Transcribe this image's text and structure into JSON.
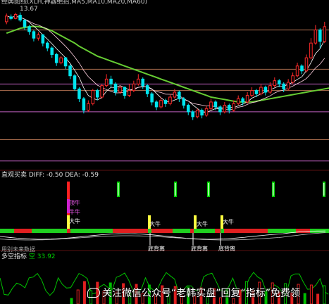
{
  "header": {
    "title_line": "经典图线(XLH,神器绝招,MA5,MA10,MA20,MA60)",
    "price_label": "13.67"
  },
  "macd_panel": {
    "title": "直观买卖",
    "diff_label": "DIFF: -0.50",
    "dea_label": "DEA: -0.59",
    "red_tag_top": "顶牛",
    "red_tag_mid": "牛牛",
    "signal_labels": [
      "大牛",
      "大牛",
      "大牛",
      "大牛"
    ],
    "divergence_labels": [
      "底背离",
      "底背离",
      "底背离"
    ]
  },
  "lower_panel": {
    "subtitle": "用别未来数据",
    "indicator_title": "多空指标",
    "indicator_value": "空 33.92"
  },
  "watermark": {
    "text": "关注微信公众号“老韩实盘”回复“指标”免费领"
  },
  "colors": {
    "up": "#ff2a2a",
    "down": "#00e5ee",
    "ma_long": "#66cc33",
    "grid_purple": "#c060c0",
    "grid_brown": "#b07050",
    "signal_green": "#00d000",
    "signal_yellow": "#ffff40",
    "signal_red": "#ff2020"
  },
  "chart_data": {
    "type": "candlestick",
    "candles": [
      {
        "o": 13.1,
        "c": 13.45,
        "h": 13.6,
        "l": 12.95
      },
      {
        "o": 13.4,
        "c": 13.3,
        "h": 13.55,
        "l": 13.2
      },
      {
        "o": 13.3,
        "c": 13.55,
        "h": 13.65,
        "l": 13.25
      },
      {
        "o": 13.5,
        "c": 13.2,
        "h": 13.67,
        "l": 13.1
      },
      {
        "o": 13.2,
        "c": 12.8,
        "h": 13.25,
        "l": 12.6
      },
      {
        "o": 12.8,
        "c": 12.5,
        "h": 12.9,
        "l": 12.3
      },
      {
        "o": 12.5,
        "c": 12.1,
        "h": 12.6,
        "l": 11.9
      },
      {
        "o": 12.1,
        "c": 12.3,
        "h": 12.45,
        "l": 11.95
      },
      {
        "o": 12.3,
        "c": 11.8,
        "h": 12.35,
        "l": 11.6
      },
      {
        "o": 11.8,
        "c": 11.5,
        "h": 11.9,
        "l": 11.3
      },
      {
        "o": 11.5,
        "c": 11.1,
        "h": 11.6,
        "l": 10.9
      },
      {
        "o": 11.1,
        "c": 10.6,
        "h": 11.2,
        "l": 10.4
      },
      {
        "o": 10.6,
        "c": 10.9,
        "h": 11.0,
        "l": 10.5
      },
      {
        "o": 10.9,
        "c": 10.4,
        "h": 10.95,
        "l": 10.2
      },
      {
        "o": 10.4,
        "c": 9.8,
        "h": 10.5,
        "l": 9.6
      },
      {
        "o": 9.8,
        "c": 9.0,
        "h": 9.9,
        "l": 8.9
      },
      {
        "o": 9.0,
        "c": 8.4,
        "h": 9.1,
        "l": 8.2
      },
      {
        "o": 8.4,
        "c": 7.7,
        "h": 8.5,
        "l": 7.5
      },
      {
        "o": 7.7,
        "c": 8.1,
        "h": 8.3,
        "l": 7.6
      },
      {
        "o": 8.1,
        "c": 8.9,
        "h": 9.0,
        "l": 8.0
      },
      {
        "o": 8.9,
        "c": 8.5,
        "h": 9.0,
        "l": 8.3
      },
      {
        "o": 8.5,
        "c": 9.2,
        "h": 9.3,
        "l": 8.4
      },
      {
        "o": 9.2,
        "c": 9.6,
        "h": 9.9,
        "l": 9.1
      },
      {
        "o": 9.6,
        "c": 9.3,
        "h": 9.8,
        "l": 9.1
      },
      {
        "o": 9.3,
        "c": 8.8,
        "h": 9.4,
        "l": 8.6
      },
      {
        "o": 8.8,
        "c": 9.1,
        "h": 9.2,
        "l": 8.7
      },
      {
        "o": 9.1,
        "c": 8.6,
        "h": 9.15,
        "l": 8.4
      },
      {
        "o": 8.6,
        "c": 8.9,
        "h": 9.3,
        "l": 8.5
      },
      {
        "o": 8.9,
        "c": 9.3,
        "h": 9.5,
        "l": 8.8
      },
      {
        "o": 9.3,
        "c": 9.6,
        "h": 9.9,
        "l": 9.2
      },
      {
        "o": 9.6,
        "c": 9.2,
        "h": 9.7,
        "l": 9.0
      },
      {
        "o": 9.2,
        "c": 8.7,
        "h": 9.3,
        "l": 8.5
      },
      {
        "o": 8.7,
        "c": 8.2,
        "h": 8.8,
        "l": 8.0
      },
      {
        "o": 8.2,
        "c": 7.9,
        "h": 8.3,
        "l": 7.7
      },
      {
        "o": 7.9,
        "c": 8.3,
        "h": 8.5,
        "l": 7.8
      },
      {
        "o": 8.3,
        "c": 8.1,
        "h": 8.4,
        "l": 7.9
      },
      {
        "o": 8.1,
        "c": 8.5,
        "h": 8.7,
        "l": 8.0
      },
      {
        "o": 8.5,
        "c": 8.8,
        "h": 9.0,
        "l": 8.4
      },
      {
        "o": 8.8,
        "c": 8.4,
        "h": 8.9,
        "l": 8.2
      },
      {
        "o": 8.4,
        "c": 8.0,
        "h": 8.5,
        "l": 7.8
      },
      {
        "o": 8.0,
        "c": 7.6,
        "h": 8.1,
        "l": 7.4
      },
      {
        "o": 7.6,
        "c": 7.3,
        "h": 7.7,
        "l": 7.1
      },
      {
        "o": 7.3,
        "c": 7.7,
        "h": 7.8,
        "l": 7.2
      },
      {
        "o": 7.7,
        "c": 7.4,
        "h": 7.8,
        "l": 7.2
      },
      {
        "o": 7.4,
        "c": 7.8,
        "h": 8.0,
        "l": 7.3
      },
      {
        "o": 7.8,
        "c": 8.2,
        "h": 8.4,
        "l": 7.7
      },
      {
        "o": 8.2,
        "c": 7.9,
        "h": 8.3,
        "l": 7.7
      },
      {
        "o": 7.9,
        "c": 7.6,
        "h": 8.0,
        "l": 7.4
      },
      {
        "o": 7.6,
        "c": 8.0,
        "h": 8.2,
        "l": 7.5
      },
      {
        "o": 8.0,
        "c": 7.7,
        "h": 8.1,
        "l": 7.5
      },
      {
        "o": 7.7,
        "c": 8.1,
        "h": 8.3,
        "l": 7.6
      },
      {
        "o": 8.1,
        "c": 8.4,
        "h": 8.6,
        "l": 8.0
      },
      {
        "o": 8.4,
        "c": 8.2,
        "h": 8.5,
        "l": 8.0
      },
      {
        "o": 8.2,
        "c": 8.6,
        "h": 8.8,
        "l": 8.1
      },
      {
        "o": 8.6,
        "c": 8.9,
        "h": 9.1,
        "l": 8.5
      },
      {
        "o": 8.9,
        "c": 8.7,
        "h": 9.0,
        "l": 8.5
      },
      {
        "o": 8.7,
        "c": 9.1,
        "h": 9.3,
        "l": 8.6
      },
      {
        "o": 9.1,
        "c": 8.8,
        "h": 9.2,
        "l": 8.6
      },
      {
        "o": 8.8,
        "c": 9.2,
        "h": 9.4,
        "l": 8.7
      },
      {
        "o": 9.2,
        "c": 9.5,
        "h": 9.7,
        "l": 9.1
      },
      {
        "o": 9.5,
        "c": 9.3,
        "h": 9.6,
        "l": 9.1
      },
      {
        "o": 9.3,
        "c": 9.0,
        "h": 9.4,
        "l": 8.8
      },
      {
        "o": 9.0,
        "c": 9.4,
        "h": 9.6,
        "l": 8.9
      },
      {
        "o": 9.4,
        "c": 9.8,
        "h": 10.0,
        "l": 9.3
      },
      {
        "o": 9.8,
        "c": 10.4,
        "h": 10.6,
        "l": 9.7
      },
      {
        "o": 10.4,
        "c": 10.1,
        "h": 10.5,
        "l": 9.9
      },
      {
        "o": 10.1,
        "c": 10.9,
        "h": 11.1,
        "l": 10.0
      },
      {
        "o": 10.9,
        "c": 11.8,
        "h": 12.1,
        "l": 10.8
      },
      {
        "o": 11.8,
        "c": 12.6,
        "h": 12.9,
        "l": 11.7
      },
      {
        "o": 12.6,
        "c": 11.9,
        "h": 12.7,
        "l": 11.5
      },
      {
        "o": 11.9,
        "c": 12.8,
        "h": 13.1,
        "l": 11.8
      }
    ],
    "ma_long": [
      12.4,
      12.5,
      12.6,
      12.7,
      12.75,
      12.8,
      12.82,
      12.8,
      12.75,
      12.65,
      12.55,
      12.4,
      12.25,
      12.1,
      11.95,
      11.8,
      11.6,
      11.45,
      11.3,
      11.15,
      11.0,
      10.9,
      10.8,
      10.7,
      10.6,
      10.5,
      10.4,
      10.3,
      10.2,
      10.1,
      10.0,
      9.9,
      9.8,
      9.7,
      9.6,
      9.5,
      9.4,
      9.3,
      9.2,
      9.1,
      9.0,
      8.9,
      8.8,
      8.7,
      8.6,
      8.5,
      8.45,
      8.4,
      8.35,
      8.3,
      8.25,
      8.2,
      8.2,
      8.2,
      8.2,
      8.25,
      8.3,
      8.35,
      8.4,
      8.45,
      8.5,
      8.55,
      8.6,
      8.65,
      8.7,
      8.75,
      8.8,
      8.85,
      8.9,
      8.95,
      9.0,
      9.05,
      9.1
    ],
    "ylim": [
      4.2,
      14.0
    ]
  }
}
